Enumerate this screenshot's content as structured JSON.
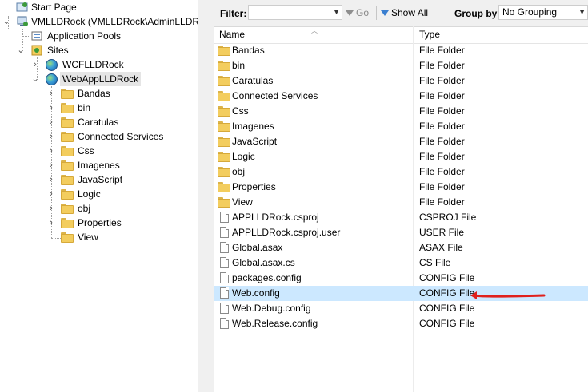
{
  "tree": {
    "start_page": "Start Page",
    "server": "VMLLDRock (VMLLDRock\\AdminLLDRock)",
    "app_pools": "Application Pools",
    "sites": "Sites",
    "site1": "WCFLLDRock",
    "site2": "WebAppLLDRock",
    "folders": [
      "Bandas",
      "bin",
      "Caratulas",
      "Connected Services",
      "Css",
      "Imagenes",
      "JavaScript",
      "Logic",
      "obj",
      "Properties",
      "View"
    ]
  },
  "toolbar": {
    "filter_label": "Filter:",
    "filter_value": "",
    "go_label": "Go",
    "show_all_label": "Show All",
    "group_by_label": "Group by:",
    "group_by_value": "No Grouping"
  },
  "list": {
    "col_name": "Name",
    "col_type": "Type",
    "rows": [
      {
        "name": "Bandas",
        "type": "File Folder",
        "icon": "folder-icon"
      },
      {
        "name": "bin",
        "type": "File Folder",
        "icon": "folder-icon"
      },
      {
        "name": "Caratulas",
        "type": "File Folder",
        "icon": "folder-icon"
      },
      {
        "name": "Connected Services",
        "type": "File Folder",
        "icon": "folder-icon"
      },
      {
        "name": "Css",
        "type": "File Folder",
        "icon": "folder-icon"
      },
      {
        "name": "Imagenes",
        "type": "File Folder",
        "icon": "folder-icon"
      },
      {
        "name": "JavaScript",
        "type": "File Folder",
        "icon": "folder-icon"
      },
      {
        "name": "Logic",
        "type": "File Folder",
        "icon": "folder-icon"
      },
      {
        "name": "obj",
        "type": "File Folder",
        "icon": "folder-icon"
      },
      {
        "name": "Properties",
        "type": "File Folder",
        "icon": "folder-icon"
      },
      {
        "name": "View",
        "type": "File Folder",
        "icon": "folder-icon"
      },
      {
        "name": "APPLLDRock.csproj",
        "type": "CSPROJ File",
        "icon": "file-icon"
      },
      {
        "name": "APPLLDRock.csproj.user",
        "type": "USER File",
        "icon": "file-icon"
      },
      {
        "name": "Global.asax",
        "type": "ASAX File",
        "icon": "file-icon"
      },
      {
        "name": "Global.asax.cs",
        "type": "CS File",
        "icon": "file-icon"
      },
      {
        "name": "packages.config",
        "type": "CONFIG File",
        "icon": "file-icon"
      },
      {
        "name": "Web.config",
        "type": "CONFIG File",
        "icon": "file-icon",
        "selected": true
      },
      {
        "name": "Web.Debug.config",
        "type": "CONFIG File",
        "icon": "file-icon"
      },
      {
        "name": "Web.Release.config",
        "type": "CONFIG File",
        "icon": "file-icon"
      }
    ]
  },
  "annotation": {
    "color": "#e0201c"
  },
  "colors": {
    "selected_row": "#cce8ff",
    "tree_selected": "#e5e5e5",
    "folder": "#f3cd5e"
  }
}
